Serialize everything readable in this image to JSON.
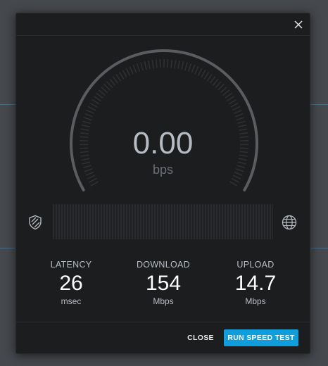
{
  "speed": {
    "value": "0.00",
    "unit": "bps"
  },
  "stats": [
    {
      "label": "LATENCY",
      "value": "26",
      "unit": "msec"
    },
    {
      "label": "DOWNLOAD",
      "value": "154",
      "unit": "Mbps"
    },
    {
      "label": "UPLOAD",
      "value": "14.7",
      "unit": "Mbps"
    }
  ],
  "footer": {
    "close_label": "CLOSE",
    "run_label": "RUN SPEED TEST"
  },
  "icons": {
    "close": "close-icon",
    "shield": "shield-icon",
    "globe": "globe-icon"
  },
  "colors": {
    "accent": "#0f9ddc",
    "modal_bg": "#1c1d1f",
    "gauge_arc": "#5a5c60"
  }
}
